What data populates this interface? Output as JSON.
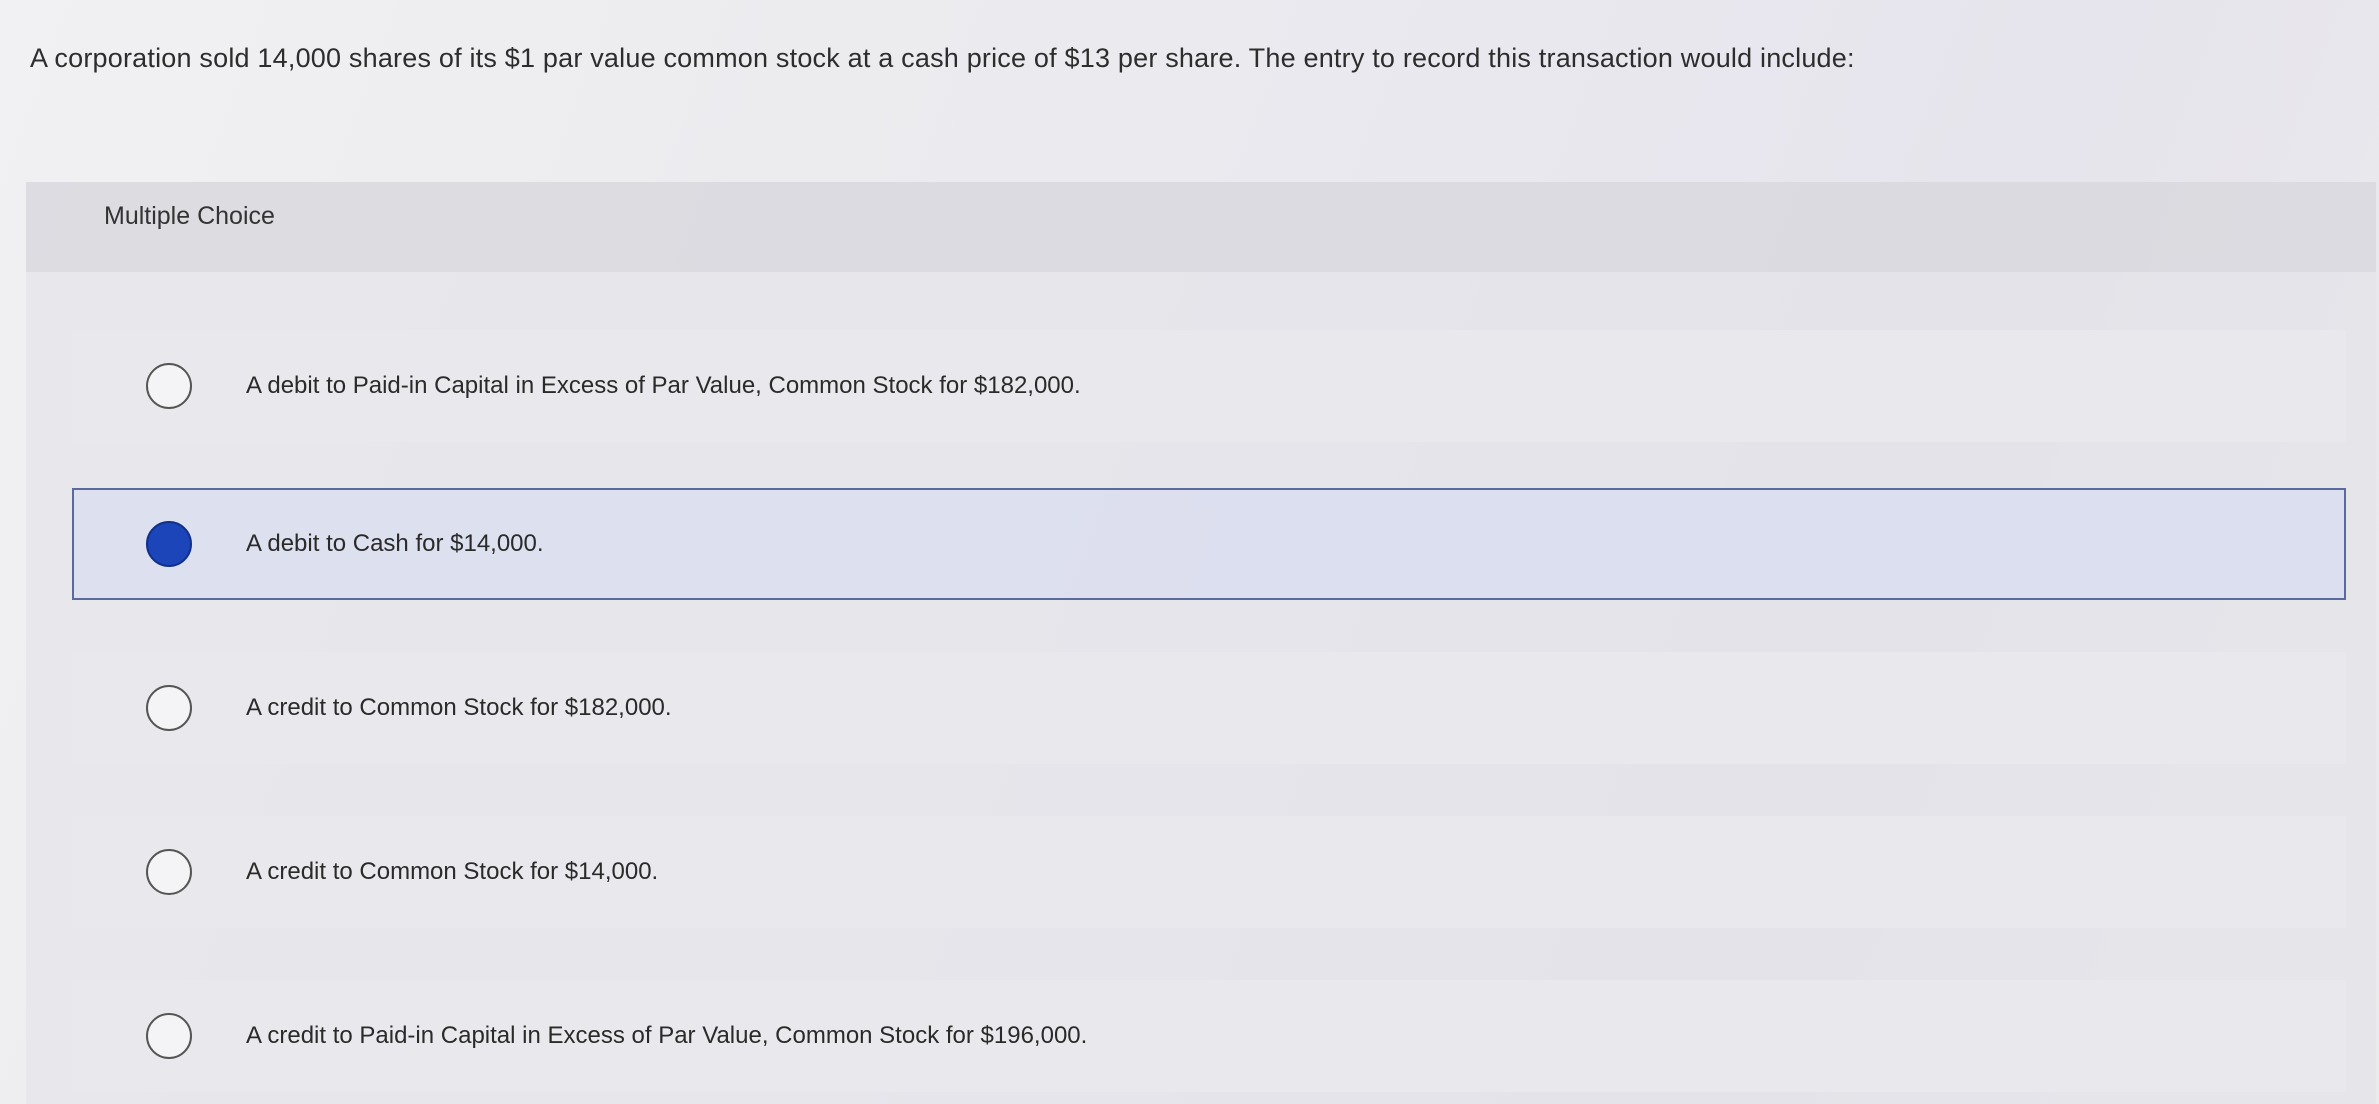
{
  "question": {
    "text": "A corporation sold 14,000 shares of its $1 par value common stock at a cash price of $13 per share. The entry to record this transaction would include:"
  },
  "multiple_choice": {
    "label": "Multiple Choice",
    "selected_index": 1,
    "options": [
      {
        "label": "A debit to Paid-in Capital in Excess of Par Value, Common Stock for $182,000.",
        "selected": false
      },
      {
        "label": "A debit to Cash for $14,000.",
        "selected": true
      },
      {
        "label": "A credit to Common Stock for $182,000.",
        "selected": false
      },
      {
        "label": "A credit to Common Stock for $14,000.",
        "selected": false
      },
      {
        "label": "A credit to Paid-in Capital in Excess of Par Value, Common Stock for $196,000.",
        "selected": false
      }
    ]
  },
  "colors": {
    "selected_radio": "#1b45b8",
    "selected_border": "#5a6a9a"
  }
}
